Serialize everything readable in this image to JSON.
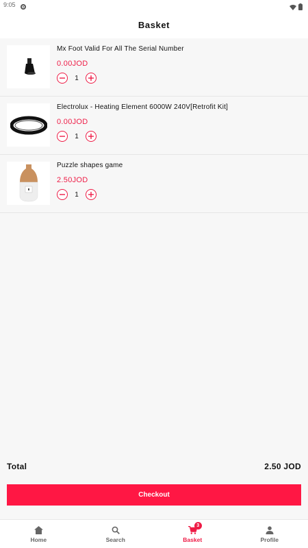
{
  "status_bar": {
    "time": "9:05"
  },
  "header": {
    "title": "Basket"
  },
  "items": [
    {
      "name": "Mx Foot Valid For All The Serial Number",
      "price": "0.00JOD",
      "quantity": "1"
    },
    {
      "name": "Electrolux - Heating Element 6000W 240V[Retrofit Kit]",
      "price": "0.00JOD",
      "quantity": "1"
    },
    {
      "name": "Puzzle shapes game",
      "price": "2.50JOD",
      "quantity": "1"
    }
  ],
  "summary": {
    "total_label": "Total",
    "total_value": "2.50 JOD"
  },
  "checkout": {
    "label": "Checkout"
  },
  "bottom_nav": {
    "home": "Home",
    "search": "Search",
    "basket": "Basket",
    "basket_badge": "3",
    "profile": "Profile"
  },
  "colors": {
    "accent": "#ee1c46",
    "checkout_bg": "#ff1744"
  },
  "icons": [
    "gear-icon",
    "wifi-icon",
    "battery-icon",
    "minus-icon",
    "plus-icon",
    "home-icon",
    "search-icon",
    "cart-icon",
    "person-icon"
  ]
}
